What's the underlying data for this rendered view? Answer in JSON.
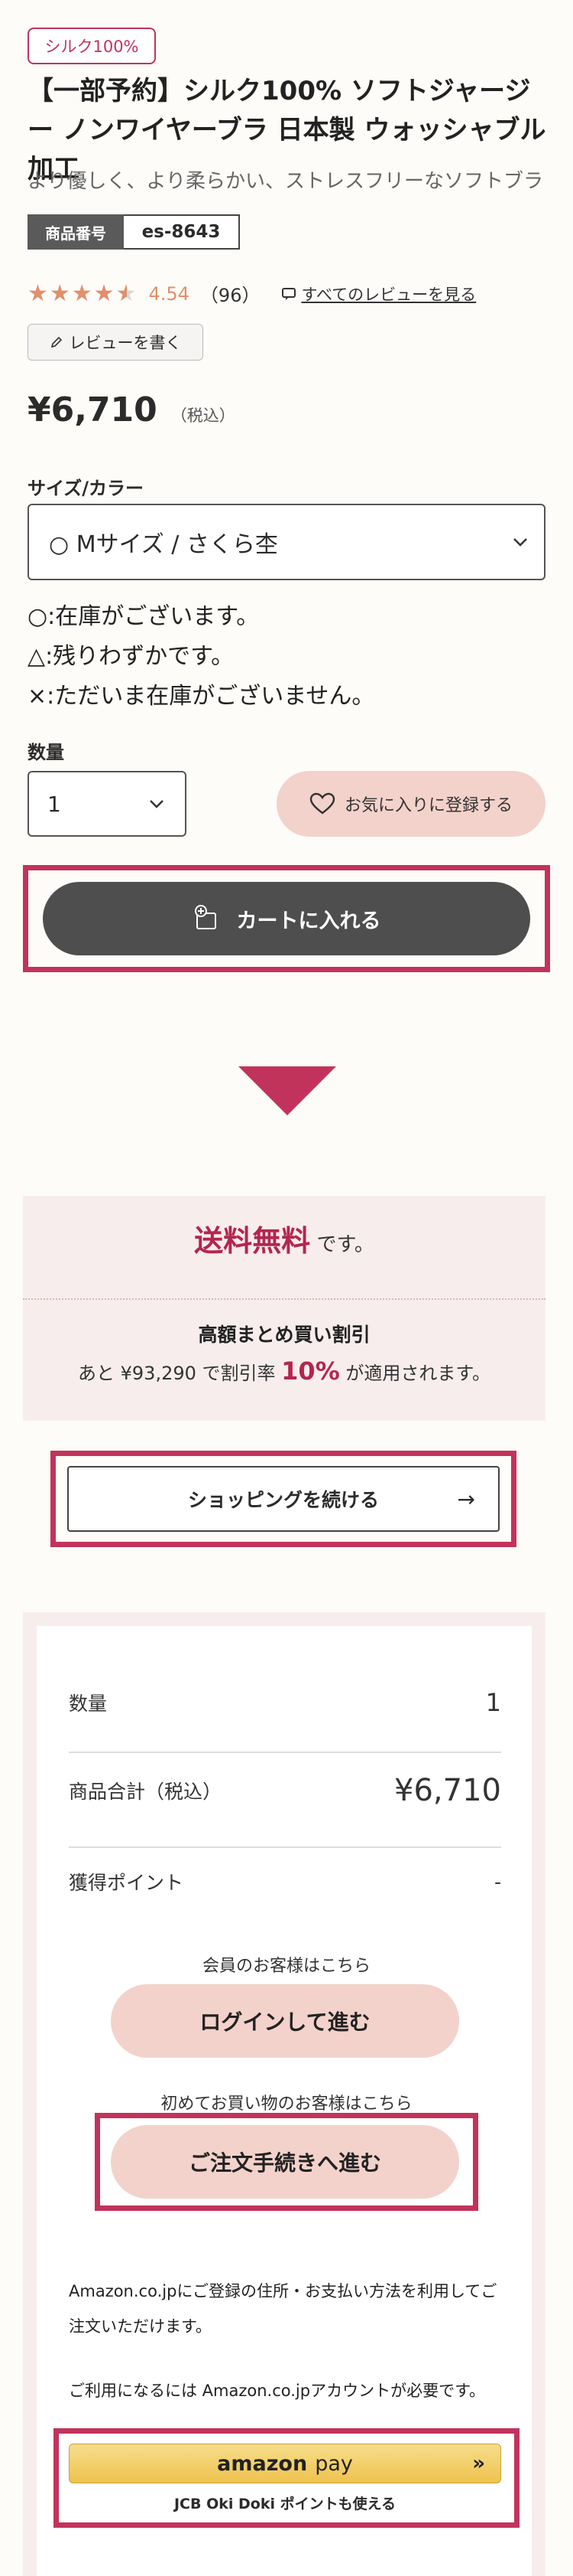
{
  "product": {
    "tag": "シルク100%",
    "title": "【一部予約】シルク100% ソフトジャージー ノンワイヤーブラ 日本製 ウォッシャブル加工",
    "subtitle": "より優しく、より柔らかい、ストレスフリーなソフトブラ",
    "sku_label": "商品番号",
    "sku_value": "es-8643",
    "rating_value": "4.54",
    "rating_count": "（96）",
    "rating_stars": 4.5,
    "review_link": "すべてのレビューを見る",
    "write_review": "レビューを書く",
    "price": "¥6,710",
    "tax_label": "（税込）"
  },
  "options": {
    "size_label": "サイズ/カラー",
    "size_selected": "○ Mサイズ / さくら杢",
    "legend_1": "○:在庫がございます。",
    "legend_2": "△:残りわずかです。",
    "legend_3": "×:ただいま在庫がございません。",
    "qty_label": "数量",
    "qty_selected": "1",
    "fav_button": "お気に入りに登録する",
    "cart_button": "カートに入れる"
  },
  "shipping": {
    "free_strong": "送料無料",
    "free_suffix": "です。",
    "bulk_title": "高額まとめ買い割引",
    "bulk_prefix": "あと ¥93,290 で割引率 ",
    "bulk_rate": "10%",
    "bulk_suffix": " が適用されます。",
    "continue_button": "ショッピングを続ける",
    "continue_arrow": "→"
  },
  "summary": {
    "qty_label": "数量",
    "qty_value": "1",
    "subtotal_label": "商品合計（税込）",
    "subtotal_value": "¥6,710",
    "points_label": "獲得ポイント",
    "points_value": "-",
    "member_note": "会員のお客様はこちら",
    "login_button": "ログインして進む",
    "first_note": "初めてお買い物のお客様はこちら",
    "order_button": "ご注文手続きへ進む",
    "amazon_note_1": "Amazon.co.jpにご登録の住所・お支払い方法を利用してご注文いただけます。",
    "amazon_note_2": "ご利用になるには Amazon.co.jpアカウントが必要です。",
    "amazon_brand": "amazon",
    "amazon_pay": "pay",
    "amazon_sub": "JCB Oki Doki ポイントも使える"
  },
  "colors": {
    "accent": "#c2335c",
    "pink_button": "#f3d2cb",
    "dark_button": "#4e4e4e",
    "star": "#e0906b"
  }
}
